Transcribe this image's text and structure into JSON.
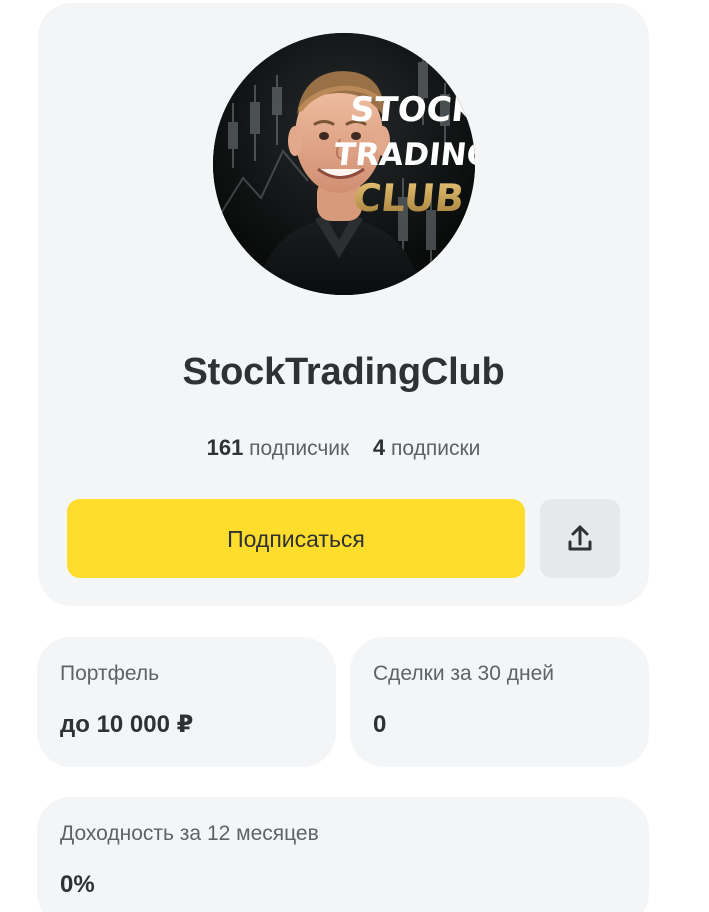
{
  "profile": {
    "avatar_text": [
      "STOCK",
      "TRADING",
      "CLUB"
    ],
    "name": "StockTradingClub",
    "followers_count": "161",
    "followers_label": "подписчик",
    "subscriptions_count": "4",
    "subscriptions_label": "подписки"
  },
  "actions": {
    "subscribe_label": "Подписаться",
    "share_icon": "share-upload-icon"
  },
  "metrics": {
    "portfolio": {
      "label": "Портфель",
      "value": "до 10 000 ₽"
    },
    "trades": {
      "label": "Сделки за 30 дней",
      "value": "0"
    },
    "return": {
      "label": "Доходность за 12 месяцев",
      "value": "0%"
    }
  },
  "colors": {
    "page_background": "#ffffff",
    "card_background": "#f4f5f7",
    "primary_button": "#ffdd2d",
    "secondary_button": "#e6e8ec",
    "text_primary": "#303133",
    "text_secondary": "#5f6267",
    "avatar_gold": "#c9a45a"
  }
}
